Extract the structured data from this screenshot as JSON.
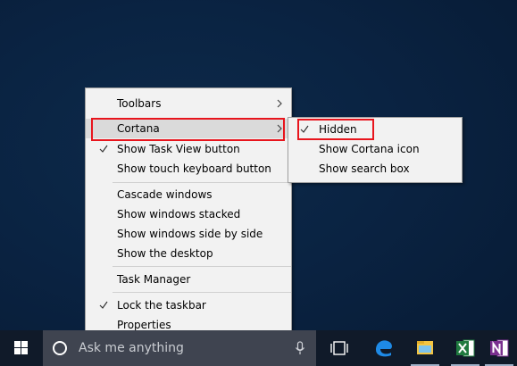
{
  "context_menu": {
    "items": [
      {
        "label": "Toolbars",
        "checked": false,
        "has_submenu": true
      },
      {
        "label": "Cortana",
        "checked": false,
        "has_submenu": true,
        "highlighted": true
      },
      {
        "label": "Show Task View button",
        "checked": true,
        "has_submenu": false
      },
      {
        "label": "Show touch keyboard button",
        "checked": false,
        "has_submenu": false
      },
      {
        "label": "Cascade windows",
        "checked": false,
        "has_submenu": false
      },
      {
        "label": "Show windows stacked",
        "checked": false,
        "has_submenu": false
      },
      {
        "label": "Show windows side by side",
        "checked": false,
        "has_submenu": false
      },
      {
        "label": "Show the desktop",
        "checked": false,
        "has_submenu": false
      },
      {
        "label": "Task Manager",
        "checked": false,
        "has_submenu": false
      },
      {
        "label": "Lock the taskbar",
        "checked": true,
        "has_submenu": false
      },
      {
        "label": "Properties",
        "checked": false,
        "has_submenu": false
      }
    ]
  },
  "cortana_submenu": {
    "items": [
      {
        "label": "Hidden",
        "checked": true
      },
      {
        "label": "Show Cortana icon",
        "checked": false
      },
      {
        "label": "Show search box",
        "checked": false
      }
    ]
  },
  "taskbar": {
    "search_placeholder": "Ask me anything",
    "pinned_apps": [
      "task-view-icon",
      "edge-icon",
      "file-explorer-icon",
      "excel-icon",
      "onenote-icon"
    ]
  },
  "colors": {
    "desktop_bg": "#0a2342",
    "menu_bg": "#f2f2f2",
    "menu_hover": "#dadada",
    "highlight_red": "#e8151d",
    "taskbar_bg": "#101a29",
    "search_bg": "#3f4450",
    "edge_blue": "#1e8ae6",
    "excel_green": "#1f7a3f",
    "onenote_purple": "#7a2f8f"
  }
}
